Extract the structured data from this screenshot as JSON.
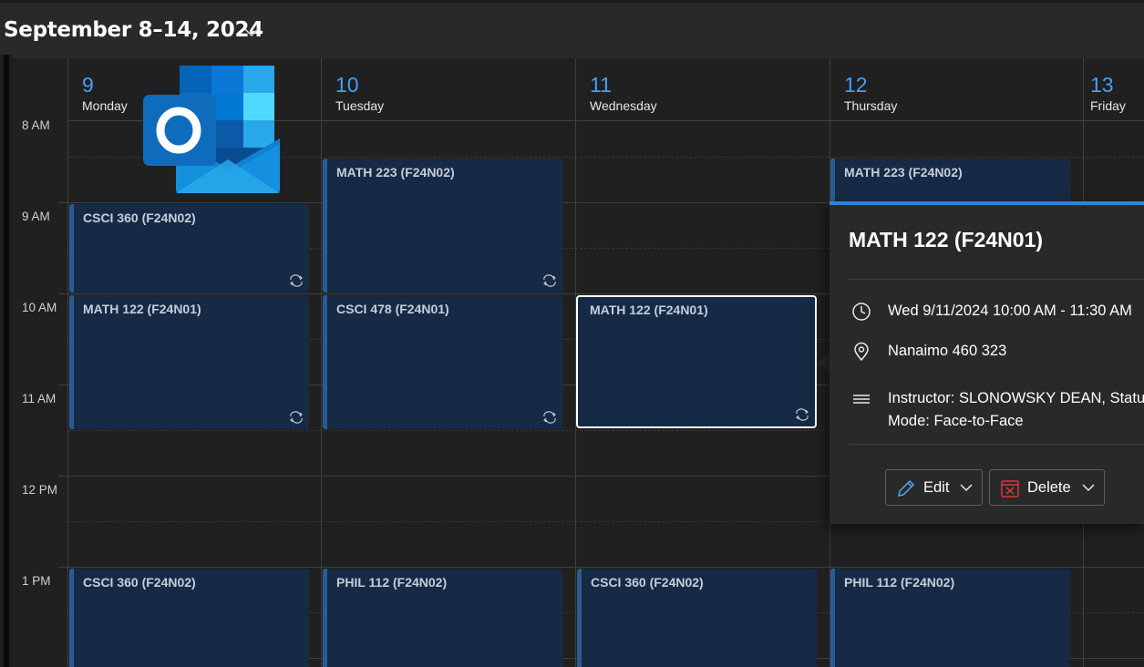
{
  "header": {
    "date_range": "September 8–14, 2024",
    "range_dropdown_icon": "chevron-down-icon"
  },
  "time_labels": [
    "8 AM",
    "9 AM",
    "10 AM",
    "11 AM",
    "12 PM",
    "1 PM"
  ],
  "days": [
    {
      "number": "9",
      "name": "Monday"
    },
    {
      "number": "10",
      "name": "Tuesday"
    },
    {
      "number": "11",
      "name": "Wednesday"
    },
    {
      "number": "12",
      "name": "Thursday"
    },
    {
      "number": "13",
      "name": "Friday"
    }
  ],
  "events": {
    "mon_csci360_am": {
      "title": "CSCI 360 (F24N02)",
      "recurring": true
    },
    "mon_math122": {
      "title": "MATH 122 (F24N01)",
      "recurring": true
    },
    "mon_csci360_pm": {
      "title": "CSCI 360 (F24N02)",
      "recurring": true
    },
    "tue_math223": {
      "title": "MATH 223 (F24N02)",
      "recurring": true
    },
    "tue_csci478": {
      "title": "CSCI 478 (F24N01)",
      "recurring": true
    },
    "tue_phil112": {
      "title": "PHIL 112 (F24N02)",
      "recurring": true
    },
    "wed_math122": {
      "title": "MATH 122 (F24N01)",
      "recurring": true,
      "selected": true
    },
    "wed_csci360": {
      "title": "CSCI 360 (F24N02)",
      "recurring": true
    },
    "thu_math223": {
      "title": "MATH 223 (F24N02)",
      "recurring": true
    },
    "thu_phil112": {
      "title": "PHIL 112 (F24N02)",
      "recurring": true
    }
  },
  "popup": {
    "title": "MATH 122 (F24N01)",
    "datetime": "Wed 9/11/2024 10:00 AM - 11:30 AM",
    "location": "Nanaimo 460 323",
    "notes_line1": "Instructor: SLONOWSKY DEAN, Status:",
    "notes_line2": "Mode: Face-to-Face",
    "edit_label": "Edit",
    "delete_label": "Delete"
  },
  "colors": {
    "accent_blue": "#479ef5",
    "event_fill": "#162a45",
    "event_bar": "#2a5c94",
    "popup_bar": "#2f84d9",
    "delete_red": "#e0323b"
  },
  "app_logo": "outlook-logo"
}
